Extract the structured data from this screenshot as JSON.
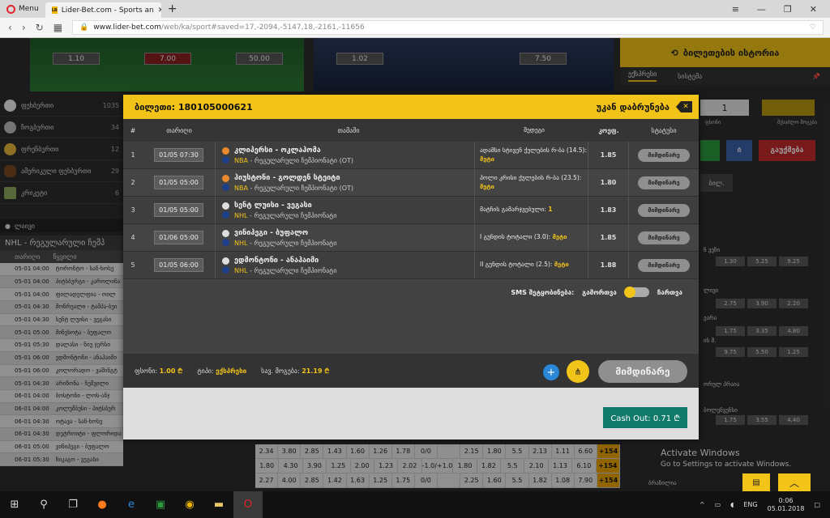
{
  "browser": {
    "menu_label": "Menu",
    "tab_title": "Lider-Bet.com - Sports an",
    "fav_text": "LB",
    "url_host": "www.lider-bet.com",
    "url_path": "/web/ka/sport#saved=17,-2094,-5147,18,-2161,-11656"
  },
  "hero": {
    "odds_left": [
      "1.10",
      "7.00",
      "50.00"
    ],
    "odds_right": [
      "1.02",
      "7.50"
    ]
  },
  "history": {
    "title": "ბილეთების ისტორია",
    "tab_express": "ექსპრესი",
    "tab_system": "სისტემა"
  },
  "sidebar": {
    "sports": [
      {
        "name": "ფეხბურთი",
        "count": "1035"
      },
      {
        "name": "ჩოგბურთი",
        "count": "34"
      },
      {
        "name": "ფრენბურთი",
        "count": "12"
      },
      {
        "name": "ამერიკული ფეხბურთი",
        "count": "29"
      },
      {
        "name": "კრიკეტი",
        "count": "6"
      }
    ],
    "live": "ლაივი",
    "league_head": "NHL - რეგულარული ჩემპ",
    "col_date": "თარიღი",
    "col_match": "წყვილი",
    "matches": [
      {
        "date": "05-01 04:00",
        "teams": "ტორონტო - სან-ხოსე"
      },
      {
        "date": "05-01 04:00",
        "teams": "პიტსბურგი - კაროლინა"
      },
      {
        "date": "05-01 04:00",
        "teams": "ფილადელფია - ოილ"
      },
      {
        "date": "05-01 04:30",
        "teams": "მონრეალი - ტამპა-ბეი"
      },
      {
        "date": "05-01 04:30",
        "teams": "სენტ ლუისი - ვეგასი"
      },
      {
        "date": "05-01 05:00",
        "teams": "მინესოტა - ბუფალო"
      },
      {
        "date": "05-01 05:30",
        "teams": "დალასი - ნიუ ჯერსი"
      },
      {
        "date": "05-01 06:00",
        "teams": "ედმონტონი - ანაჰაიმი"
      },
      {
        "date": "05-01 06:00",
        "teams": "კოლორადო - ვაშინგტ"
      },
      {
        "date": "05-01 04:30",
        "teams": "არიზონა - ნეშვილი"
      },
      {
        "date": "06-01 04:00",
        "teams": "ბოსტონი - ლოს-ანჯ"
      },
      {
        "date": "06-01 04:00",
        "teams": "კოლუმბუსი - პიტსბურ"
      },
      {
        "date": "06-01 04:30",
        "teams": "ოტავა - სან-ხოსე"
      },
      {
        "date": "06-01 04:30",
        "teams": "დეტროიტი - ფლორიდა"
      },
      {
        "date": "06-01 05:00",
        "teams": "ვინიპეგი - ბუფალო"
      },
      {
        "date": "06-01 05:30",
        "teams": "ჩიკაგო - ვეგასი"
      }
    ]
  },
  "bottom_rows": [
    [
      "2.34",
      "3.80",
      "2.85",
      "1.43",
      "1.60",
      "1.26",
      "1.78",
      "0/0",
      "",
      "2.15",
      "1.80",
      "5.5",
      "2.13",
      "1.11",
      "6.60",
      "+154"
    ],
    [
      "1.80",
      "4.30",
      "3.90",
      "1.25",
      "2.00",
      "1.23",
      "2.02",
      "-1.0/+1.0",
      "1.80",
      "1.82",
      "5.5",
      "2.10",
      "1.13",
      "6.10",
      "+154"
    ],
    [
      "2.27",
      "4.00",
      "2.85",
      "1.42",
      "1.63",
      "1.25",
      "1.75",
      "0/0",
      "",
      "2.25",
      "1.60",
      "5.5",
      "1.82",
      "1.08",
      "7.90",
      "+154"
    ]
  ],
  "right": {
    "stake": "1",
    "lbl_stake": "ფსონი",
    "lbl_win": "შესაძლო მოგება",
    "cancel": "გაუქმება",
    "tab_label": "ბილ.",
    "odds_rows": [
      [
        "1.30",
        "5.25",
        "9.25"
      ],
      [
        "2.75",
        "3.90",
        "2.20"
      ],
      [
        "1.75",
        "3.35",
        "4.80"
      ],
      [
        "9.75",
        "5.50",
        "1.25"
      ],
      [
        "1.75",
        "3.55",
        "4.40"
      ]
    ],
    "labels": [
      "ნ ვეზი",
      "ლივი",
      "ეარა",
      "ის მ.",
      "ორულ პრაია",
      "ბოლენვენსი"
    ],
    "footer_team": "ბრაზილია"
  },
  "ticket": {
    "label": "ბილეთი:",
    "number": "180105000621",
    "back_label": "უკან დაბრუნება",
    "headers": {
      "num": "#",
      "date": "თარიღი",
      "match": "თამაში",
      "outcome": "შედეგი",
      "odds": "კოეფ.",
      "status": "სტატუსი"
    },
    "rows": [
      {
        "num": "1",
        "date": "01/05 07:30",
        "teams": "კლიპერსი - ოკლაჰომა",
        "league": "NBA",
        "league_rest": " - რეგულარული ჩემპიონატი (OT)",
        "outcome": "ადამსი სტივენ ქულების რ-ბა (14.5): ",
        "outcome_val": "მეტი",
        "odds": "1.85",
        "status": "მიმდინარე"
      },
      {
        "num": "2",
        "date": "01/05 05:00",
        "teams": "ჰიუსტონი - გოლდენ სტეიტი",
        "league": "NBA",
        "league_rest": " - რეგულარული ჩემპიონატი (OT)",
        "outcome": "პოლი კრისი ქულების რ-ბა (23.5): ",
        "outcome_val": "მეტი",
        "odds": "1.80",
        "status": "მიმდინარე"
      },
      {
        "num": "3",
        "date": "01/05 05:00",
        "teams": "სენტ ლუისი - ვეგასი",
        "league": "NHL",
        "league_rest": " - რეგულარული ჩემპიონატი",
        "outcome": "მატჩის გამარჯვებული: ",
        "outcome_val": "1",
        "odds": "1.83",
        "status": "მიმდინარე"
      },
      {
        "num": "4",
        "date": "01/06 05:00",
        "teams": "ვინიპეგი - ბუფალო",
        "league": "NHL",
        "league_rest": " - რეგულარული ჩემპიონატი",
        "outcome": "I გუნდის ტოტალი (3.0): ",
        "outcome_val": "მეტი",
        "odds": "1.85",
        "status": "მიმდინარე"
      },
      {
        "num": "5",
        "date": "01/05 06:00",
        "teams": "ედმონტონი - ანაჰაიმი",
        "league": "NHL",
        "league_rest": " - რეგულარული ჩემპიონატი",
        "outcome": "II გუნდის ტოტალი (2.5): ",
        "outcome_val": "მეტი",
        "odds": "1.88",
        "status": "მიმდინარე"
      }
    ],
    "sms_label": "SMS შეტყობინება:",
    "sms_off": "გამორთვა",
    "sms_on": "ჩართვა",
    "stake_label": "ფსონი:",
    "stake_value": "1.00 ₾",
    "type_label": "ტიპი:",
    "type_value": "ექსპრესი",
    "win_label": "სავ. მოგება:",
    "win_value": "21.19 ₾",
    "current_label": "მიმდინარე",
    "cashout": "Cash Out: 0.71 ₾"
  },
  "watermark": {
    "line1": "Activate Windows",
    "line2": "Go to Settings to activate Windows."
  },
  "taskbar": {
    "lang": "ENG",
    "time": "0:06",
    "date": "05.01.2018"
  },
  "colors": {
    "accent": "#f2c318",
    "modal_bg": "#424242",
    "cashout": "#127a6a",
    "plus": "#2a86d6"
  }
}
